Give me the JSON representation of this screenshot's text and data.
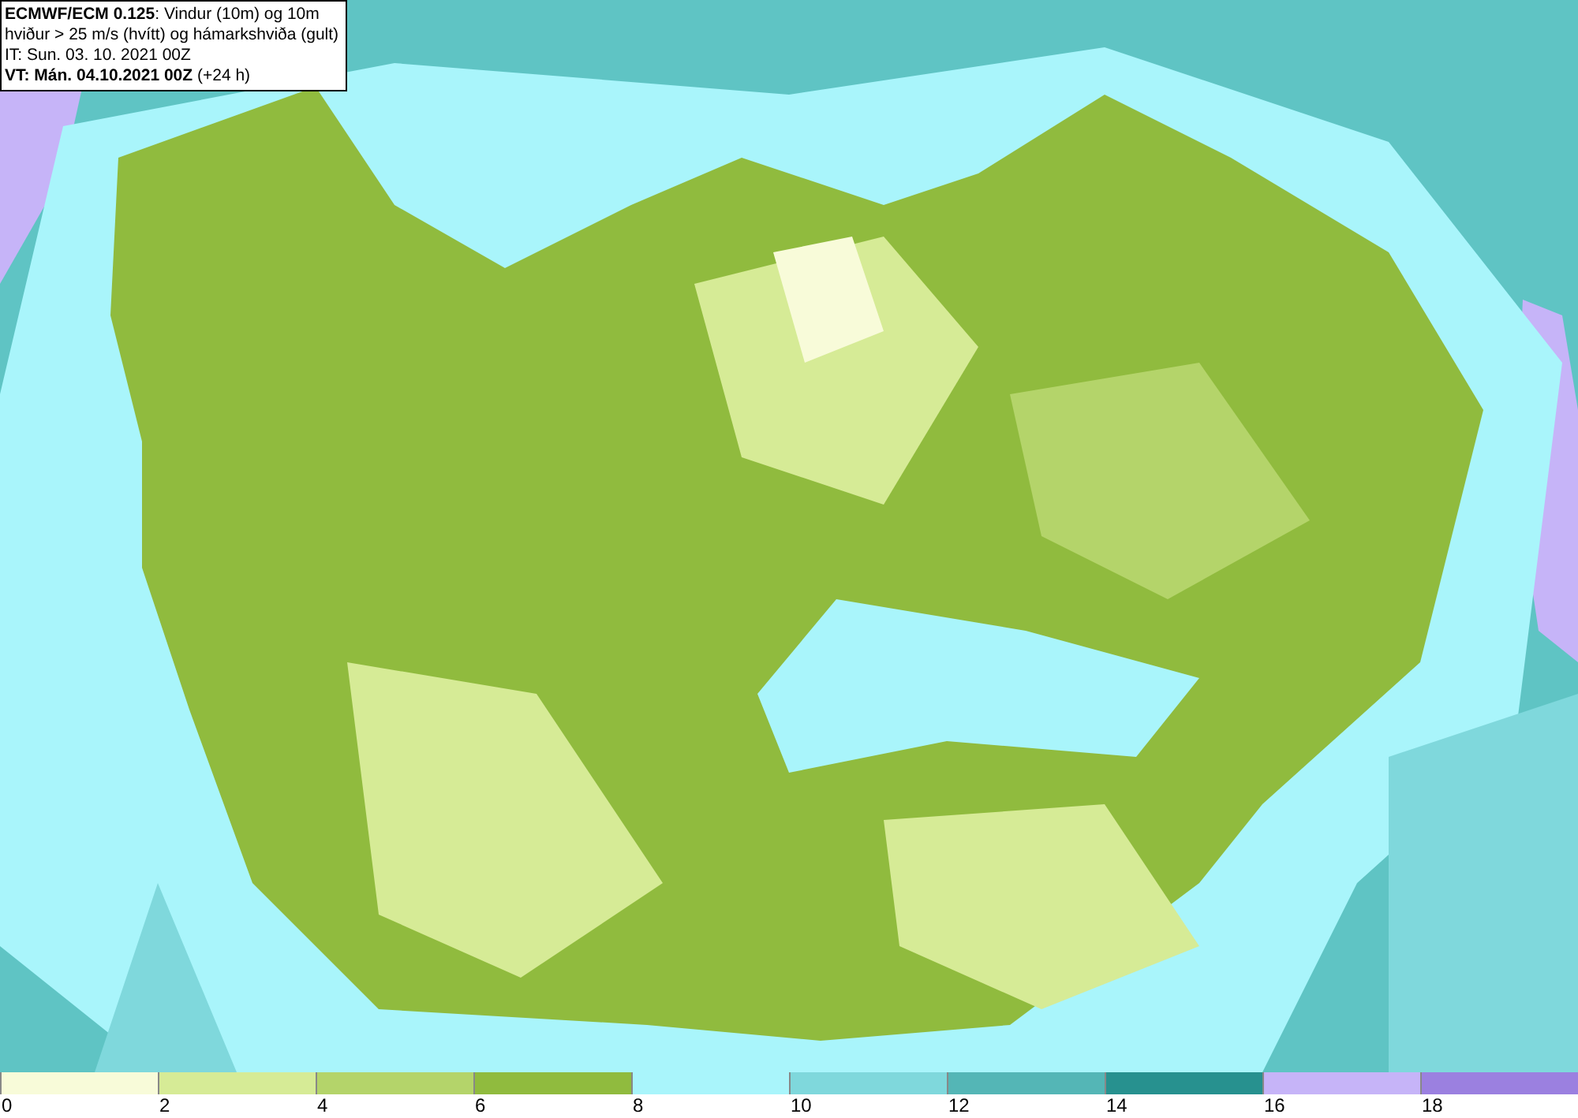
{
  "caption": {
    "lines": [
      "**ECMWF/ECM 0.125**: Vindur (10m) og 10m",
      "hviður > 25 m/s (hvítt) og hámarkshviða (gult)",
      "IT: Sun. 03. 10. 2021 00Z",
      "**VT: Mán. 04.10.2021 00Z** (+24 h)"
    ]
  },
  "legend": [
    {
      "label": "0",
      "color": "#f8fbd9"
    },
    {
      "label": "2",
      "color": "#d6eb96"
    },
    {
      "label": "4",
      "color": "#b4d46a"
    },
    {
      "label": "6",
      "color": "#90bb3e"
    },
    {
      "label": "8",
      "color": "#a9f5fb"
    },
    {
      "label": "10",
      "color": "#7fd8dc"
    },
    {
      "label": "12",
      "color": "#54b6b6"
    },
    {
      "label": "14",
      "color": "#27918f"
    },
    {
      "label": "16",
      "color": "#c6b4f8"
    },
    {
      "label": "18",
      "color": "#9b80e0"
    }
  ]
}
